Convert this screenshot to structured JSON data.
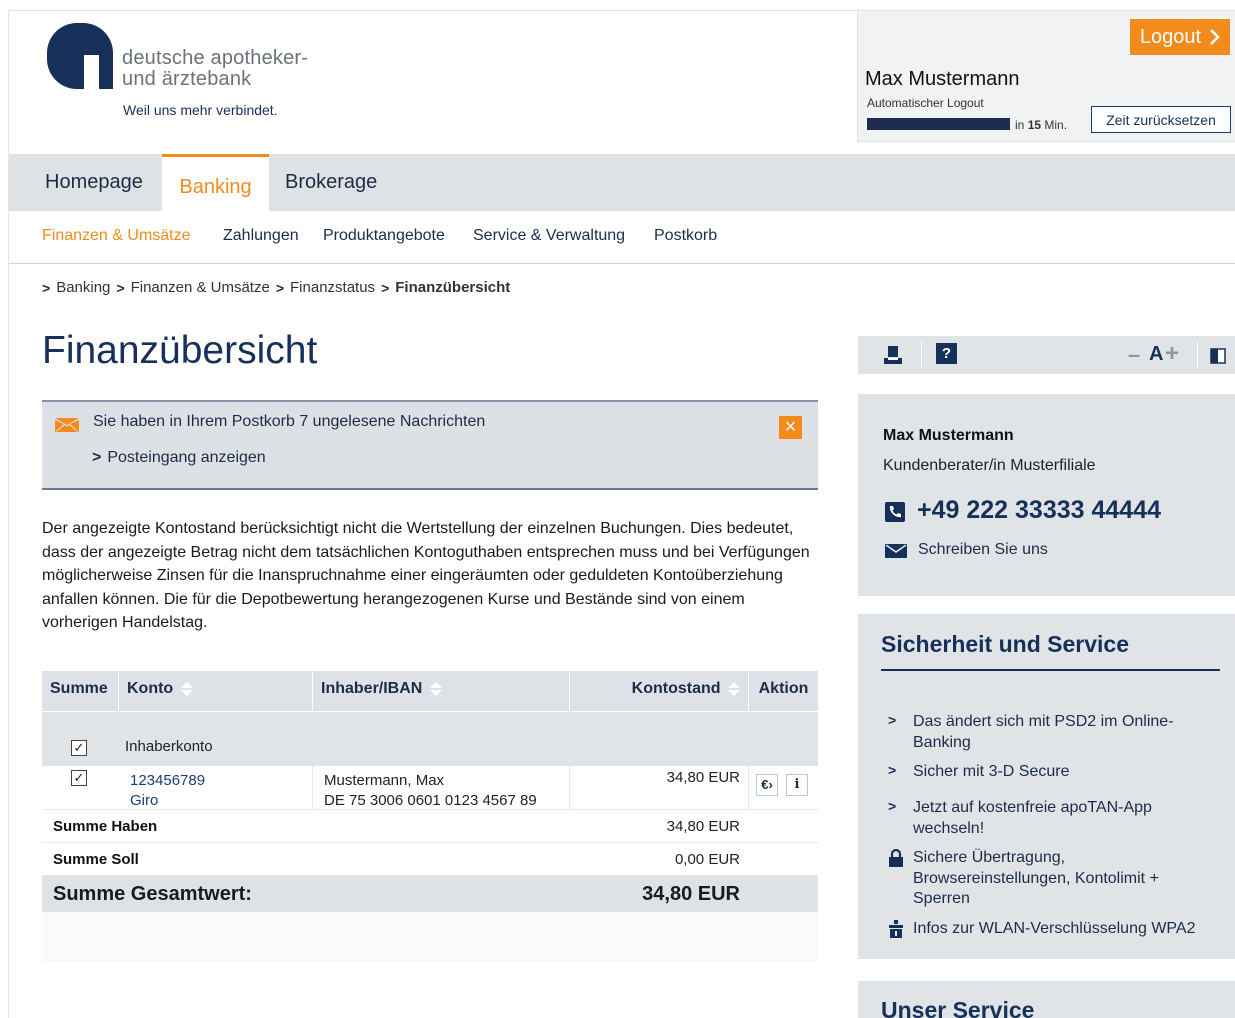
{
  "brand": {
    "name_line1": "deutsche apotheker-",
    "name_line2": "und ärztebank",
    "slogan": "Weil uns mehr verbindet.",
    "primary_color": "#16305a",
    "accent_color": "#f28a1c"
  },
  "session": {
    "logout_label": "Logout",
    "user_name": "Max Mustermann",
    "auto_logout_label": "Automatischer Logout",
    "remaining_prefix": "in",
    "remaining_value": "15",
    "remaining_unit": "Min.",
    "remaining_fraction": 1.0,
    "reset_label": "Zeit zurücksetzen"
  },
  "main_nav": [
    {
      "label": "Homepage",
      "active": false
    },
    {
      "label": "Banking",
      "active": true
    },
    {
      "label": "Brokerage",
      "active": false
    }
  ],
  "sub_nav": [
    {
      "label": "Finanzen & Umsätze",
      "active": true
    },
    {
      "label": "Zahlungen",
      "active": false
    },
    {
      "label": "Produktangebote",
      "active": false
    },
    {
      "label": "Service & Verwaltung",
      "active": false
    },
    {
      "label": "Postkorb",
      "active": false
    }
  ],
  "breadcrumb": [
    "Banking",
    "Finanzen & Umsätze",
    "Finanzstatus",
    "Finanzübersicht"
  ],
  "page_title": "Finanzübersicht",
  "notice": {
    "text": "Sie haben in Ihrem Postkorb 7 ungelesene Nachrichten",
    "link": "Posteingang anzeigen",
    "close_icon": "close-icon"
  },
  "disclaimer": "Der angezeigte Kontostand berücksichtigt nicht die Wertstellung der einzelnen Buchungen. Dies bedeutet, dass der angezeigte Betrag nicht dem tatsächlichen Kontoguthaben entsprechen muss und bei Verfügungen möglicherweise Zinsen für die Inanspruchnahme einer eingeräumten oder geduldeten Kontoüberziehung anfallen können. Die für die Depotbewertung herangezogenen Kurse und Bestände sind von einem vorherigen Handelstag.",
  "table": {
    "headers": {
      "summe": "Summe",
      "konto": "Konto",
      "inhaber": "Inhaber/IBAN",
      "kontostand": "Kontostand",
      "aktion": "Aktion"
    },
    "group_label": "Inhaberkonto",
    "accounts": [
      {
        "number": "123456789",
        "type": "Giro",
        "owner": "Mustermann, Max",
        "iban": "DE 75 3006 0601 0123 4567 89",
        "balance": "34,80 EUR",
        "checked": true
      }
    ],
    "summe_haben_label": "Summe Haben",
    "summe_haben_value": "34,80 EUR",
    "summe_soll_label": "Summe Soll",
    "summe_soll_value": "0,00 EUR",
    "total_label": "Summe Gesamtwert:",
    "total_value": "34,80 EUR"
  },
  "toolbar": {
    "font_label": "A"
  },
  "contact": {
    "name": "Max Mustermann",
    "role": "Kundenberater/in Musterfiliale",
    "phone": "+49 222 33333 44444",
    "mail_label": "Schreiben Sie uns"
  },
  "security": {
    "title": "Sicherheit und Service",
    "items": [
      {
        "label": "Das ändert sich mit PSD2 im Online-Banking",
        "icon": "chevron-right-icon"
      },
      {
        "label": "Sicher mit 3-D Secure",
        "icon": "chevron-right-icon"
      },
      {
        "label": "Jetzt auf kostenfreie apoTAN-App wechseln!",
        "icon": "chevron-right-icon"
      },
      {
        "label": "Sichere Übertragung, Browsereinstellungen, Kontolimit + Sperren",
        "icon": "lock-icon"
      },
      {
        "label": "Infos zur WLAN-Verschlüsselung WPA2",
        "icon": "wlan-icon"
      }
    ]
  },
  "unser_service": {
    "title": "Unser Service"
  }
}
